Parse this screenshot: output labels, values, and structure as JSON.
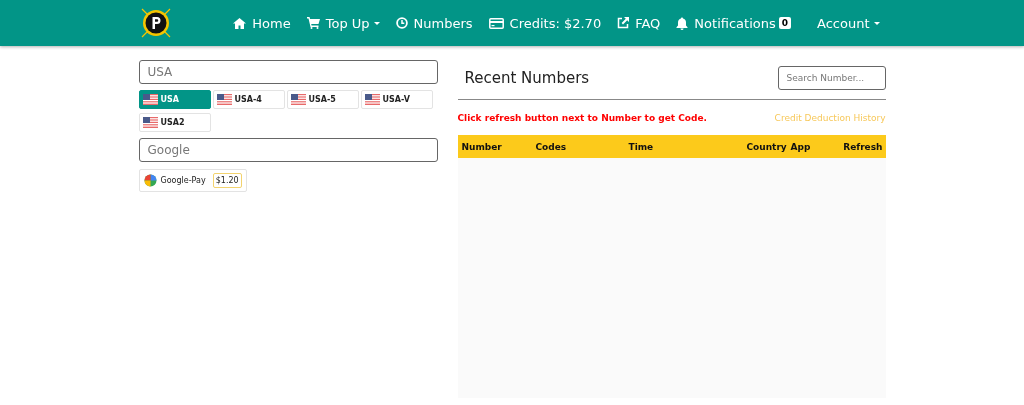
{
  "navbar": {
    "items": [
      {
        "kind": "link",
        "label": "Home"
      },
      {
        "kind": "dropdown",
        "label": "Top Up"
      },
      {
        "kind": "link",
        "label": "Numbers"
      },
      {
        "kind": "link",
        "label": "Credits: $2.70"
      },
      {
        "kind": "link",
        "label": "FAQ"
      },
      {
        "kind": "link",
        "label": "Notifications",
        "badge": "0"
      },
      {
        "kind": "dropdown",
        "label": "Account"
      }
    ]
  },
  "country_search": {
    "placeholder": "USA"
  },
  "countries": [
    {
      "label": "USA",
      "selected": true
    },
    {
      "label": "USA-4",
      "selected": false
    },
    {
      "label": "USA-5",
      "selected": false
    },
    {
      "label": "USA-V",
      "selected": false
    },
    {
      "label": "USA2",
      "selected": false
    }
  ],
  "service_search": {
    "placeholder": "Google"
  },
  "services": [
    {
      "name": "Google-Pay",
      "price": "$1.20"
    }
  ],
  "recent": {
    "title": "Recent Numbers",
    "search": {
      "placeholder": "Search Number..."
    },
    "notice": "Click refresh button next to Number to get Code.",
    "history_link": "Credit Deduction History",
    "table": {
      "columns": [
        "Number",
        "Codes",
        "Time",
        "Country",
        "App",
        "Refresh"
      ]
    }
  }
}
